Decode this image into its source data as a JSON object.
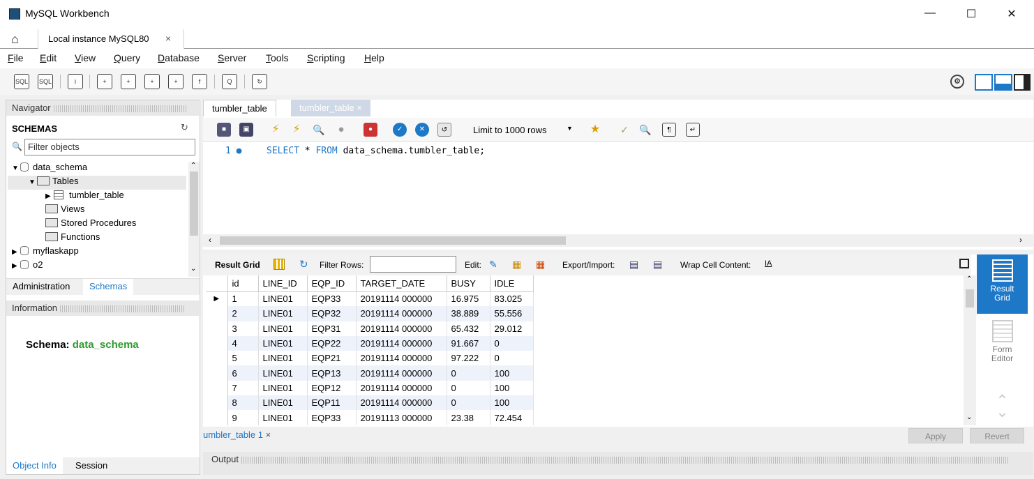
{
  "window": {
    "title": "MySQL Workbench"
  },
  "conn_tab": {
    "label": "Local instance MySQL80"
  },
  "menu": [
    "File",
    "Edit",
    "View",
    "Query",
    "Database",
    "Server",
    "Tools",
    "Scripting",
    "Help"
  ],
  "menu_underline": [
    "F",
    "E",
    "V",
    "Q",
    "D",
    "S",
    "T",
    "S",
    "H"
  ],
  "navigator": {
    "header": "Navigator",
    "schemas_label": "SCHEMAS",
    "filter_placeholder": "Filter objects",
    "tree": [
      {
        "label": "data_schema",
        "type": "db",
        "expanded": true
      },
      {
        "label": "Tables",
        "type": "folder",
        "expanded": true
      },
      {
        "label": "tumbler_table",
        "type": "table"
      },
      {
        "label": "Views",
        "type": "folder"
      },
      {
        "label": "Stored Procedures",
        "type": "folder"
      },
      {
        "label": "Functions",
        "type": "folder"
      },
      {
        "label": "myflaskapp",
        "type": "db"
      },
      {
        "label": "o2",
        "type": "db"
      }
    ],
    "tabs": [
      "Administration",
      "Schemas"
    ],
    "info_header": "Information",
    "schema_info_label": "Schema:",
    "schema_info_value": "data_schema",
    "bottom_tabs": [
      "Object Info",
      "Session"
    ]
  },
  "editor": {
    "tabs": [
      "tumbler_table",
      "tumbler_table"
    ],
    "limit": "Limit to 1000 rows",
    "line_number": "1",
    "sql_keyword1": "SELECT",
    "sql_star": "*",
    "sql_keyword2": "FROM",
    "sql_rest": "data_schema.tumbler_table;"
  },
  "results": {
    "result_grid_label": "Result Grid",
    "filter_rows_label": "Filter Rows:",
    "edit_label": "Edit:",
    "export_label": "Export/Import:",
    "wrap_label": "Wrap Cell Content:",
    "columns": [
      "id",
      "LINE_ID",
      "EQP_ID",
      "TARGET_DATE",
      "BUSY",
      "IDLE"
    ],
    "rows": [
      [
        "1",
        "LINE01",
        "EQP33",
        "20191114 000000",
        "16.975",
        "83.025"
      ],
      [
        "2",
        "LINE01",
        "EQP32",
        "20191114 000000",
        "38.889",
        "55.556"
      ],
      [
        "3",
        "LINE01",
        "EQP31",
        "20191114 000000",
        "65.432",
        "29.012"
      ],
      [
        "4",
        "LINE01",
        "EQP22",
        "20191114 000000",
        "91.667",
        "0"
      ],
      [
        "5",
        "LINE01",
        "EQP21",
        "20191114 000000",
        "97.222",
        "0"
      ],
      [
        "6",
        "LINE01",
        "EQP13",
        "20191114 000000",
        "0",
        "100"
      ],
      [
        "7",
        "LINE01",
        "EQP12",
        "20191114 000000",
        "0",
        "100"
      ],
      [
        "8",
        "LINE01",
        "EQP11",
        "20191114 000000",
        "0",
        "100"
      ],
      [
        "9",
        "LINE01",
        "EQP33",
        "20191113 000000",
        "23.38",
        "72.454"
      ]
    ],
    "side_result_grid": "Result Grid",
    "side_form_editor": "Form Editor",
    "result_tab": "umbler_table 1",
    "apply": "Apply",
    "revert": "Revert"
  },
  "output": {
    "label": "Output"
  },
  "colors": {
    "accent": "#1e78c8",
    "schema_green": "#2e9a2e",
    "side_active": "#1e78c8"
  }
}
